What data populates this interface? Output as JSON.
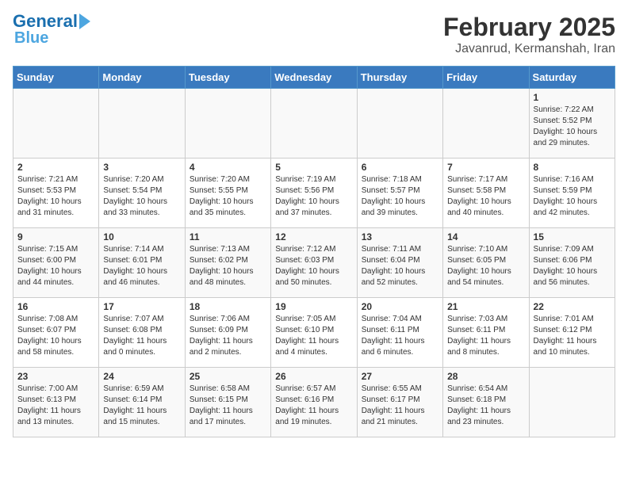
{
  "header": {
    "logo_line1": "General",
    "logo_line2": "Blue",
    "title": "February 2025",
    "subtitle": "Javanrud, Kermanshah, Iran"
  },
  "weekdays": [
    "Sunday",
    "Monday",
    "Tuesday",
    "Wednesday",
    "Thursday",
    "Friday",
    "Saturday"
  ],
  "weeks": [
    [
      {
        "day": "",
        "info": ""
      },
      {
        "day": "",
        "info": ""
      },
      {
        "day": "",
        "info": ""
      },
      {
        "day": "",
        "info": ""
      },
      {
        "day": "",
        "info": ""
      },
      {
        "day": "",
        "info": ""
      },
      {
        "day": "1",
        "info": "Sunrise: 7:22 AM\nSunset: 5:52 PM\nDaylight: 10 hours\nand 29 minutes."
      }
    ],
    [
      {
        "day": "2",
        "info": "Sunrise: 7:21 AM\nSunset: 5:53 PM\nDaylight: 10 hours\nand 31 minutes."
      },
      {
        "day": "3",
        "info": "Sunrise: 7:20 AM\nSunset: 5:54 PM\nDaylight: 10 hours\nand 33 minutes."
      },
      {
        "day": "4",
        "info": "Sunrise: 7:20 AM\nSunset: 5:55 PM\nDaylight: 10 hours\nand 35 minutes."
      },
      {
        "day": "5",
        "info": "Sunrise: 7:19 AM\nSunset: 5:56 PM\nDaylight: 10 hours\nand 37 minutes."
      },
      {
        "day": "6",
        "info": "Sunrise: 7:18 AM\nSunset: 5:57 PM\nDaylight: 10 hours\nand 39 minutes."
      },
      {
        "day": "7",
        "info": "Sunrise: 7:17 AM\nSunset: 5:58 PM\nDaylight: 10 hours\nand 40 minutes."
      },
      {
        "day": "8",
        "info": "Sunrise: 7:16 AM\nSunset: 5:59 PM\nDaylight: 10 hours\nand 42 minutes."
      }
    ],
    [
      {
        "day": "9",
        "info": "Sunrise: 7:15 AM\nSunset: 6:00 PM\nDaylight: 10 hours\nand 44 minutes."
      },
      {
        "day": "10",
        "info": "Sunrise: 7:14 AM\nSunset: 6:01 PM\nDaylight: 10 hours\nand 46 minutes."
      },
      {
        "day": "11",
        "info": "Sunrise: 7:13 AM\nSunset: 6:02 PM\nDaylight: 10 hours\nand 48 minutes."
      },
      {
        "day": "12",
        "info": "Sunrise: 7:12 AM\nSunset: 6:03 PM\nDaylight: 10 hours\nand 50 minutes."
      },
      {
        "day": "13",
        "info": "Sunrise: 7:11 AM\nSunset: 6:04 PM\nDaylight: 10 hours\nand 52 minutes."
      },
      {
        "day": "14",
        "info": "Sunrise: 7:10 AM\nSunset: 6:05 PM\nDaylight: 10 hours\nand 54 minutes."
      },
      {
        "day": "15",
        "info": "Sunrise: 7:09 AM\nSunset: 6:06 PM\nDaylight: 10 hours\nand 56 minutes."
      }
    ],
    [
      {
        "day": "16",
        "info": "Sunrise: 7:08 AM\nSunset: 6:07 PM\nDaylight: 10 hours\nand 58 minutes."
      },
      {
        "day": "17",
        "info": "Sunrise: 7:07 AM\nSunset: 6:08 PM\nDaylight: 11 hours\nand 0 minutes."
      },
      {
        "day": "18",
        "info": "Sunrise: 7:06 AM\nSunset: 6:09 PM\nDaylight: 11 hours\nand 2 minutes."
      },
      {
        "day": "19",
        "info": "Sunrise: 7:05 AM\nSunset: 6:10 PM\nDaylight: 11 hours\nand 4 minutes."
      },
      {
        "day": "20",
        "info": "Sunrise: 7:04 AM\nSunset: 6:11 PM\nDaylight: 11 hours\nand 6 minutes."
      },
      {
        "day": "21",
        "info": "Sunrise: 7:03 AM\nSunset: 6:11 PM\nDaylight: 11 hours\nand 8 minutes."
      },
      {
        "day": "22",
        "info": "Sunrise: 7:01 AM\nSunset: 6:12 PM\nDaylight: 11 hours\nand 10 minutes."
      }
    ],
    [
      {
        "day": "23",
        "info": "Sunrise: 7:00 AM\nSunset: 6:13 PM\nDaylight: 11 hours\nand 13 minutes."
      },
      {
        "day": "24",
        "info": "Sunrise: 6:59 AM\nSunset: 6:14 PM\nDaylight: 11 hours\nand 15 minutes."
      },
      {
        "day": "25",
        "info": "Sunrise: 6:58 AM\nSunset: 6:15 PM\nDaylight: 11 hours\nand 17 minutes."
      },
      {
        "day": "26",
        "info": "Sunrise: 6:57 AM\nSunset: 6:16 PM\nDaylight: 11 hours\nand 19 minutes."
      },
      {
        "day": "27",
        "info": "Sunrise: 6:55 AM\nSunset: 6:17 PM\nDaylight: 11 hours\nand 21 minutes."
      },
      {
        "day": "28",
        "info": "Sunrise: 6:54 AM\nSunset: 6:18 PM\nDaylight: 11 hours\nand 23 minutes."
      },
      {
        "day": "",
        "info": ""
      }
    ]
  ]
}
